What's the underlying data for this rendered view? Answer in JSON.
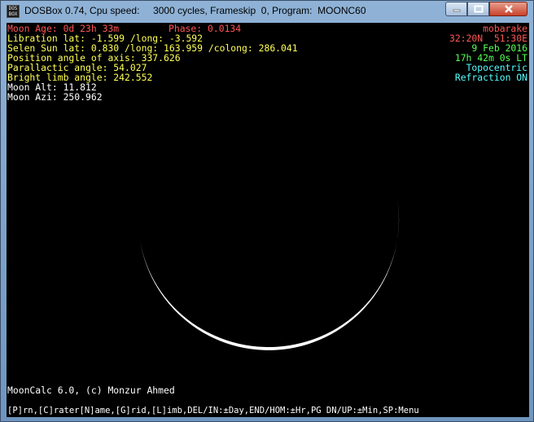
{
  "window": {
    "title": "DOSBox 0.74, Cpu speed:     3000 cycles, Frameskip  0, Program:  MOONC60",
    "icon_text": "DOS BOX",
    "minimize_icon": "minimize-icon",
    "maximize_icon": "maximize-icon",
    "close_icon": "close-icon"
  },
  "info": {
    "moon_age": "Moon Age: 0d 23h 33m",
    "phase": "Phase: 0.0134",
    "libration": "Libration lat: -1.599 /long: -3.592",
    "selen_sun": "Selen Sun lat: 0.830 /long: 163.959 /colong: 286.041",
    "position_angle": "Position angle of axis: 337.626",
    "parallactic_angle": "Parallactic angle: 54.027",
    "bright_limb": "Bright limb angle: 242.552",
    "moon_alt": "Moon Alt: 11.812",
    "moon_azi": "Moon Azi: 250.962"
  },
  "location": {
    "name": "mobarake",
    "coords": "32:20N  51:30E",
    "date": "9 Feb 2016",
    "time": "17h 42m 0s LT",
    "mode": "Topocentric",
    "refraction": "Refraction ON"
  },
  "footer": {
    "credit": "MoonCalc 6.0, (c) Monzur Ahmed",
    "commands": "[P]rn,[C]rater[N]ame,[G]rid,[L]imb,DEL/IN:±Day,END/HOM:±Hr,PG DN/UP:±Min,SP:Menu"
  },
  "colors": {
    "red": "#ff5555",
    "yellow": "#ffff55",
    "green": "#55ff55",
    "cyan": "#55ffff",
    "white": "#ffffff",
    "background": "#000000"
  }
}
